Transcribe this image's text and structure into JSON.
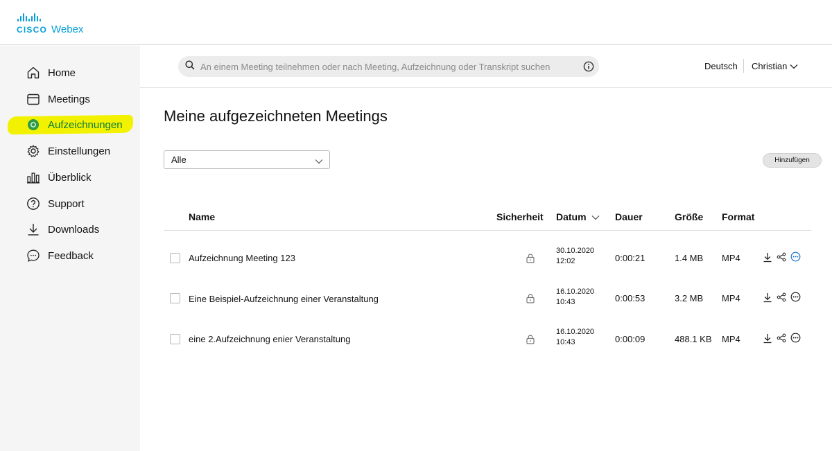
{
  "brand": {
    "cisco": "CISCO",
    "webex": "Webex"
  },
  "sidebar": {
    "items": [
      {
        "label": "Home",
        "icon": "home-icon"
      },
      {
        "label": "Meetings",
        "icon": "calendar-icon"
      },
      {
        "label": "Aufzeichnungen",
        "icon": "record-icon",
        "active": true
      },
      {
        "label": "Einstellungen",
        "icon": "gear-icon"
      },
      {
        "label": "Überblick",
        "icon": "bar-chart-icon"
      },
      {
        "label": "Support",
        "icon": "help-icon"
      },
      {
        "label": "Downloads",
        "icon": "download-icon"
      },
      {
        "label": "Feedback",
        "icon": "chat-icon"
      }
    ]
  },
  "header": {
    "search_placeholder": "An einem Meeting teilnehmen oder nach Meeting, Aufzeichnung oder Transkript suchen",
    "language": "Deutsch",
    "user": "Christian"
  },
  "main": {
    "title": "Meine aufgezeichneten Meetings",
    "filter_value": "Alle",
    "add_button": "Hinzufügen",
    "columns": {
      "name": "Name",
      "security": "Sicherheit",
      "date": "Datum",
      "duration": "Dauer",
      "size": "Größe",
      "format": "Format"
    },
    "rows": [
      {
        "name": "Aufzeichnung Meeting 123",
        "date": "30.10.2020",
        "time": "12:02",
        "duration": "0:00:21",
        "size": "1.4 MB",
        "format": "MP4"
      },
      {
        "name": "Eine Beispiel-Aufzeichnung einer Veranstaltung",
        "date": "16.10.2020",
        "time": "10:43",
        "duration": "0:00:53",
        "size": "3.2 MB",
        "format": "MP4"
      },
      {
        "name": "eine 2.Aufzeichnung enier Veranstaltung",
        "date": "16.10.2020",
        "time": "10:43",
        "duration": "0:00:09",
        "size": "488.1 KB",
        "format": "MP4"
      }
    ]
  },
  "colors": {
    "brand": "#049fd9",
    "active": "#0a7a3a",
    "highlight": "#f2f200",
    "sidebar_bg": "#f5f5f5"
  }
}
